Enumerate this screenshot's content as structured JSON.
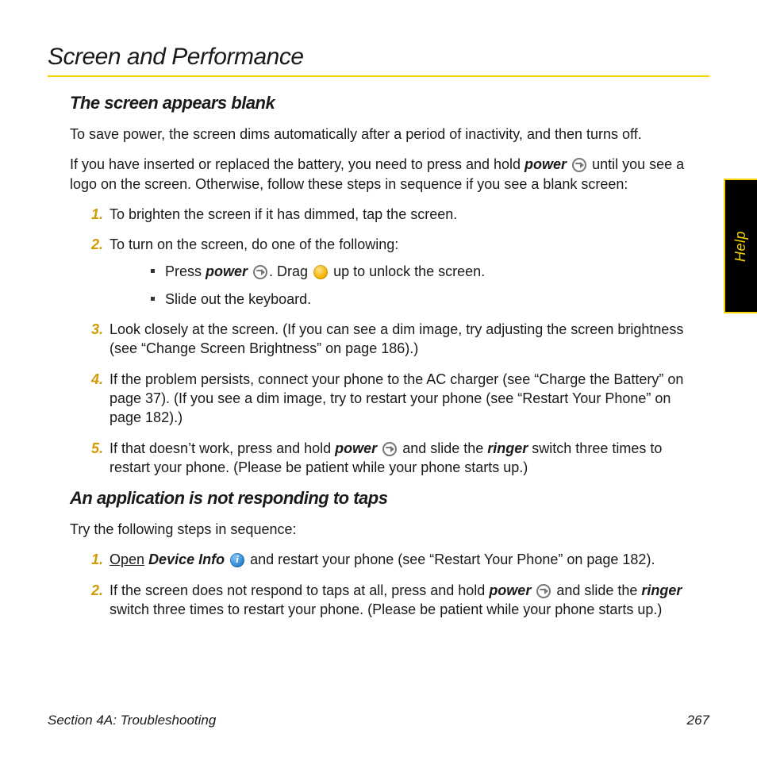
{
  "title": "Screen and Performance",
  "side_tab": "Help",
  "sub1": {
    "heading": "The screen appears blank",
    "p1": "To save power, the screen dims automatically after a period of inactivity, and then turns off.",
    "p2a": "If you have inserted or replaced the battery, you need to press and hold ",
    "p2_power": "power",
    "p2b": " until you see a logo on the screen. Otherwise, follow these steps in sequence if you see a blank screen:",
    "steps": {
      "s1": "To brighten the screen if it has dimmed, tap the screen.",
      "s2": "To turn on the screen, do one of the following:",
      "s2a_press": "Press ",
      "s2a_power": "power",
      "s2a_drag": ". Drag ",
      "s2a_end": " up to unlock the screen.",
      "s2b": "Slide out the keyboard.",
      "s3": "Look closely at the screen. (If you can see a dim image, try adjusting the screen brightness (see “Change Screen Brightness” on page 186).)",
      "s4": "If the problem persists, connect your phone to the AC charger (see “Charge the Battery” on page 37). (If you see a dim image, try to restart your phone (see “Restart Your Phone” on page 182).)",
      "s5a": "If that doesn’t work, press and hold ",
      "s5_power": "power",
      "s5b": " and slide the ",
      "s5_ringer": "ringer",
      "s5c": " switch three times to restart your phone. (Please be patient while your phone starts up.)"
    }
  },
  "sub2": {
    "heading": "An application is not responding to taps",
    "p1": "Try the following steps in sequence:",
    "steps": {
      "s1_open": "Open",
      "s1_devinfo": "Device Info",
      "s1_rest": " and restart your phone (see “Restart Your Phone” on page 182).",
      "s2a": "If the screen does not respond to taps at all, press and hold ",
      "s2_power": "power",
      "s2b": " and slide the ",
      "s2_ringer": "ringer",
      "s2c": " switch three times to restart your phone. (Please be patient while your phone starts up.)"
    }
  },
  "footer": {
    "section": "Section 4A: Troubleshooting",
    "page": "267"
  },
  "nums": {
    "n1": "1.",
    "n2": "2.",
    "n3": "3.",
    "n4": "4.",
    "n5": "5."
  }
}
